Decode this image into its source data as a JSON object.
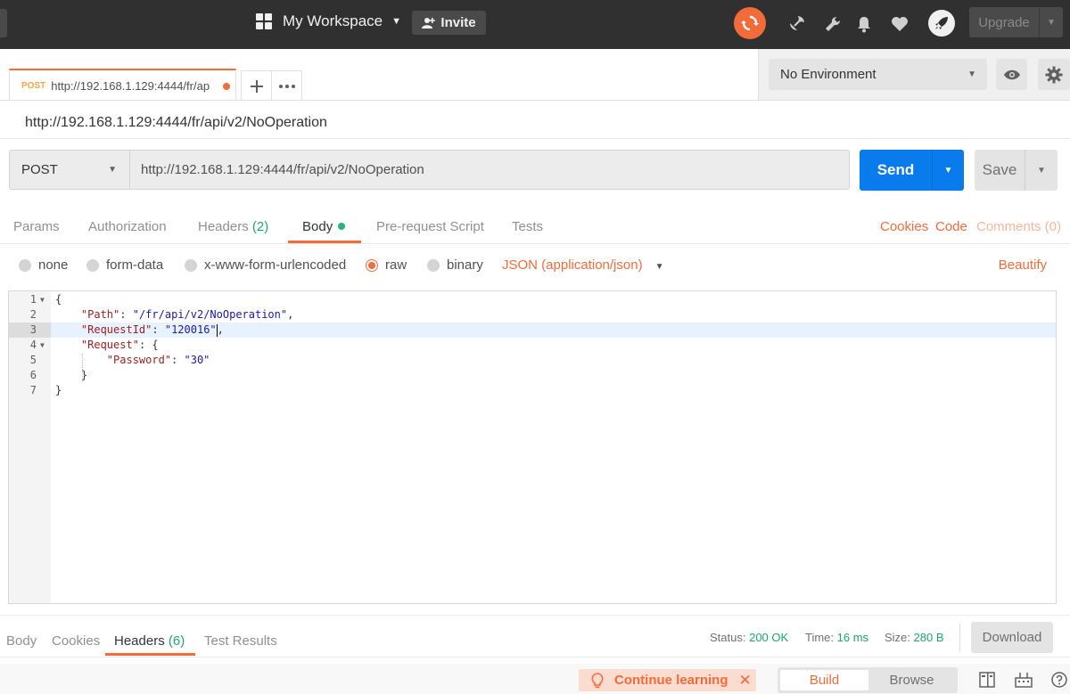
{
  "header": {
    "workspace_label": "My Workspace",
    "invite_label": "Invite",
    "upgrade_label": "Upgrade"
  },
  "tabs": [
    {
      "method": "POST",
      "title": "http://192.168.1.129:4444/fr/ap"
    }
  ],
  "environment": {
    "selected": "No Environment"
  },
  "request": {
    "title": "http://192.168.1.129:4444/fr/api/v2/NoOperation",
    "method": "POST",
    "url": "http://192.168.1.129:4444/fr/api/v2/NoOperation",
    "send_label": "Send",
    "save_label": "Save"
  },
  "request_tabs": {
    "params": "Params",
    "authorization": "Authorization",
    "headers": "Headers",
    "headers_count": "(2)",
    "body": "Body",
    "prerequest": "Pre-request Script",
    "tests": "Tests",
    "cookies": "Cookies",
    "code": "Code",
    "comments": "Comments (0)"
  },
  "body_types": {
    "none": "none",
    "form_data": "form-data",
    "urlencoded": "x-www-form-urlencoded",
    "raw": "raw",
    "binary": "binary",
    "content_type": "JSON (application/json)",
    "beautify": "Beautify",
    "selected": "raw"
  },
  "editor": {
    "line_numbers": [
      "1",
      "2",
      "3",
      "4",
      "5",
      "6",
      "7"
    ],
    "l1": "{",
    "l2_key": "\"Path\"",
    "l2_val": "\"/fr/api/v2/NoOperation\"",
    "l3_key": "\"RequestId\"",
    "l3_val": "\"120016\"",
    "l4_key": "\"Request\"",
    "l4_brace": "{",
    "l5_key": "\"Password\"",
    "l5_val": "\"30\"",
    "l6": "}",
    "l7": "}"
  },
  "response": {
    "tab_body": "Body",
    "tab_cookies": "Cookies",
    "tab_headers": "Headers",
    "tab_headers_count": "(6)",
    "tab_tests": "Test Results",
    "status_label": "Status:",
    "status_value": "200 OK",
    "time_label": "Time:",
    "time_value": "16 ms",
    "size_label": "Size:",
    "size_value": "280 B",
    "download_label": "Download"
  },
  "footer": {
    "learning_label": "Continue learning",
    "build_label": "Build",
    "browse_label": "Browse"
  },
  "colors": {
    "accent": "#f26b3a",
    "send": "#097bed",
    "success": "#1fa56c"
  }
}
